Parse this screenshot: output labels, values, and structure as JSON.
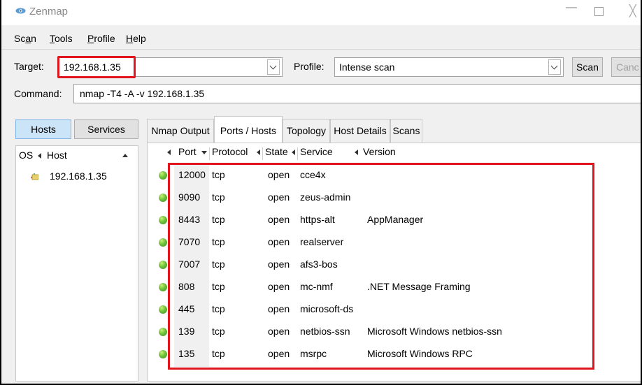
{
  "window": {
    "title": "Zenmap"
  },
  "menu": [
    {
      "pre": "Sc",
      "ul": "a",
      "post": "n"
    },
    {
      "pre": "",
      "ul": "T",
      "post": "ools"
    },
    {
      "pre": "",
      "ul": "P",
      "post": "rofile"
    },
    {
      "pre": "",
      "ul": "H",
      "post": "elp"
    }
  ],
  "toolbar": {
    "target_label": "Target:",
    "target_value": "192.168.1.35",
    "profile_label": "Profile:",
    "profile_value": "Intense scan",
    "scan_button": "Scan",
    "cancel_button": "Canc"
  },
  "command": {
    "label": "Command:",
    "value": "nmap -T4 -A -v 192.168.1.35"
  },
  "left_pane": {
    "hosts_button": "Hosts",
    "services_button": "Services",
    "col_os": "OS",
    "col_host": "Host",
    "hosts": [
      {
        "name": "192.168.1.35"
      }
    ]
  },
  "tabs": [
    {
      "label": "Nmap Output",
      "active": false
    },
    {
      "label": "Ports / Hosts",
      "active": true
    },
    {
      "label": "Topology",
      "active": false
    },
    {
      "label": "Host Details",
      "active": false
    },
    {
      "label": "Scans",
      "active": false
    }
  ],
  "ports_table": {
    "headers": {
      "port": "Port",
      "protocol": "Protocol",
      "state": "State",
      "service": "Service",
      "version": "Version"
    },
    "rows": [
      {
        "port": "12000",
        "protocol": "tcp",
        "state": "open",
        "service": "cce4x",
        "version": ""
      },
      {
        "port": "9090",
        "protocol": "tcp",
        "state": "open",
        "service": "zeus-admin",
        "version": ""
      },
      {
        "port": "8443",
        "protocol": "tcp",
        "state": "open",
        "service": "https-alt",
        "version": "AppManager"
      },
      {
        "port": "7070",
        "protocol": "tcp",
        "state": "open",
        "service": "realserver",
        "version": ""
      },
      {
        "port": "7007",
        "protocol": "tcp",
        "state": "open",
        "service": "afs3-bos",
        "version": ""
      },
      {
        "port": "808",
        "protocol": "tcp",
        "state": "open",
        "service": "mc-nmf",
        "version": ".NET Message Framing"
      },
      {
        "port": "445",
        "protocol": "tcp",
        "state": "open",
        "service": "microsoft-ds",
        "version": ""
      },
      {
        "port": "139",
        "protocol": "tcp",
        "state": "open",
        "service": "netbios-ssn",
        "version": "Microsoft Windows netbios-ssn"
      },
      {
        "port": "135",
        "protocol": "tcp",
        "state": "open",
        "service": "msrpc",
        "version": "Microsoft Windows RPC"
      }
    ]
  },
  "colors": {
    "highlight": "#e0141c",
    "open_port": "#6fc23a",
    "active_button": "#cce4f7"
  }
}
